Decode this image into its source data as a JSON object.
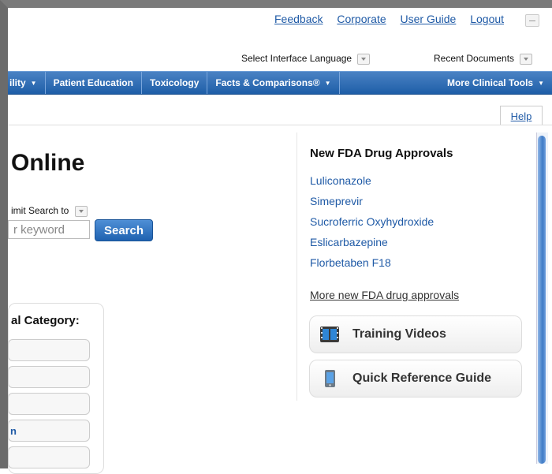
{
  "top_links": [
    "Feedback",
    "Corporate",
    "User Guide",
    "Logout"
  ],
  "language": {
    "label": "Select Interface Language"
  },
  "recent": {
    "label": "Recent Documents"
  },
  "nav": {
    "items": [
      "ility",
      "Patient Education",
      "Toxicology",
      "Facts & Comparisons®",
      "More Clinical Tools"
    ]
  },
  "help": "Help",
  "main": {
    "title": "Online",
    "limit_label": "imit Search to",
    "search_placeholder": "r keyword",
    "search_button": "Search"
  },
  "category": {
    "title": "al Category:",
    "items": [
      "",
      "",
      "",
      "n",
      ""
    ]
  },
  "fda": {
    "title": "New FDA Drug Approvals",
    "drugs": [
      "Luliconazole",
      "Simeprevir",
      "Sucroferric Oxyhydroxide",
      "Eslicarbazepine",
      "Florbetaben F18"
    ],
    "more": "More new FDA drug approvals"
  },
  "features": {
    "training": "Training Videos",
    "quickref": "Quick Reference Guide"
  },
  "colors": {
    "accent": "#1f5aa6",
    "nav_bg": "#2a68b2"
  }
}
